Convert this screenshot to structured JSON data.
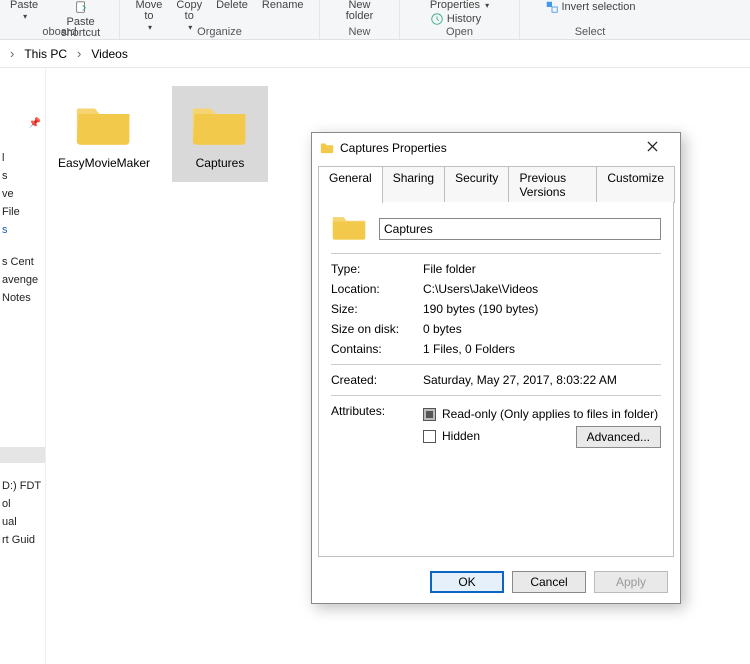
{
  "ribbon": {
    "group1": {
      "paste": "Paste",
      "paste_shortcut": "Paste shortcut",
      "label": "oboard"
    },
    "group2": {
      "move_to": "Move\nto",
      "copy_to": "Copy\nto",
      "delete": "Delete",
      "rename": "Rename",
      "label": "Organize"
    },
    "group3": {
      "new_folder": "New\nfolder",
      "label": "New"
    },
    "group4": {
      "properties": "Properties",
      "history": "History",
      "label": "Open"
    },
    "group5": {
      "invert_selection": "Invert selection",
      "label": "Select"
    }
  },
  "breadcrumb": {
    "pc": "This PC",
    "videos": "Videos"
  },
  "sidebar": {
    "e1": "l",
    "e2": "s",
    "e3": "ve",
    "e4": "File",
    "e5": "s",
    "e6": "s Cent",
    "e7": "avenge",
    "e8": "Notes",
    "e9": "D:) FDT",
    "e10": "ol",
    "e11": "ual",
    "e12": "rt Guid"
  },
  "folders": [
    {
      "name": "EasyMovieMaker",
      "selected": false
    },
    {
      "name": "Captures",
      "selected": true
    }
  ],
  "dialog": {
    "title": "Captures Properties",
    "tabs": {
      "general": "General",
      "sharing": "Sharing",
      "security": "Security",
      "previous": "Previous Versions",
      "customize": "Customize"
    },
    "name_value": "Captures",
    "rows": {
      "type_k": "Type:",
      "type_v": "File folder",
      "location_k": "Location:",
      "location_v": "C:\\Users\\Jake\\Videos",
      "size_k": "Size:",
      "size_v": "190 bytes (190 bytes)",
      "sizeondisk_k": "Size on disk:",
      "sizeondisk_v": "0 bytes",
      "contains_k": "Contains:",
      "contains_v": "1 Files, 0 Folders",
      "created_k": "Created:",
      "created_v": "Saturday, May 27, 2017, 8:03:22 AM",
      "attributes_k": "Attributes:"
    },
    "checkboxes": {
      "readonly": "Read-only (Only applies to files in folder)",
      "hidden": "Hidden"
    },
    "advanced": "Advanced...",
    "buttons": {
      "ok": "OK",
      "cancel": "Cancel",
      "apply": "Apply"
    }
  }
}
